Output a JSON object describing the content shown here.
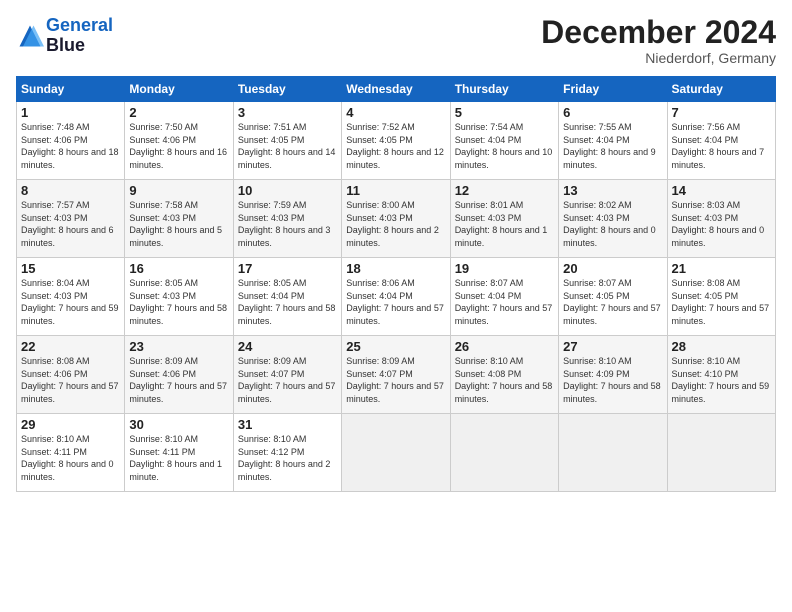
{
  "header": {
    "logo_line1": "General",
    "logo_line2": "Blue",
    "month_title": "December 2024",
    "location": "Niederdorf, Germany"
  },
  "days_of_week": [
    "Sunday",
    "Monday",
    "Tuesday",
    "Wednesday",
    "Thursday",
    "Friday",
    "Saturday"
  ],
  "weeks": [
    [
      {
        "num": "1",
        "sunrise": "7:48 AM",
        "sunset": "4:06 PM",
        "daylight": "8 hours and 18 minutes."
      },
      {
        "num": "2",
        "sunrise": "7:50 AM",
        "sunset": "4:06 PM",
        "daylight": "8 hours and 16 minutes."
      },
      {
        "num": "3",
        "sunrise": "7:51 AM",
        "sunset": "4:05 PM",
        "daylight": "8 hours and 14 minutes."
      },
      {
        "num": "4",
        "sunrise": "7:52 AM",
        "sunset": "4:05 PM",
        "daylight": "8 hours and 12 minutes."
      },
      {
        "num": "5",
        "sunrise": "7:54 AM",
        "sunset": "4:04 PM",
        "daylight": "8 hours and 10 minutes."
      },
      {
        "num": "6",
        "sunrise": "7:55 AM",
        "sunset": "4:04 PM",
        "daylight": "8 hours and 9 minutes."
      },
      {
        "num": "7",
        "sunrise": "7:56 AM",
        "sunset": "4:04 PM",
        "daylight": "8 hours and 7 minutes."
      }
    ],
    [
      {
        "num": "8",
        "sunrise": "7:57 AM",
        "sunset": "4:03 PM",
        "daylight": "8 hours and 6 minutes."
      },
      {
        "num": "9",
        "sunrise": "7:58 AM",
        "sunset": "4:03 PM",
        "daylight": "8 hours and 5 minutes."
      },
      {
        "num": "10",
        "sunrise": "7:59 AM",
        "sunset": "4:03 PM",
        "daylight": "8 hours and 3 minutes."
      },
      {
        "num": "11",
        "sunrise": "8:00 AM",
        "sunset": "4:03 PM",
        "daylight": "8 hours and 2 minutes."
      },
      {
        "num": "12",
        "sunrise": "8:01 AM",
        "sunset": "4:03 PM",
        "daylight": "8 hours and 1 minute."
      },
      {
        "num": "13",
        "sunrise": "8:02 AM",
        "sunset": "4:03 PM",
        "daylight": "8 hours and 0 minutes."
      },
      {
        "num": "14",
        "sunrise": "8:03 AM",
        "sunset": "4:03 PM",
        "daylight": "8 hours and 0 minutes."
      }
    ],
    [
      {
        "num": "15",
        "sunrise": "8:04 AM",
        "sunset": "4:03 PM",
        "daylight": "7 hours and 59 minutes."
      },
      {
        "num": "16",
        "sunrise": "8:05 AM",
        "sunset": "4:03 PM",
        "daylight": "7 hours and 58 minutes."
      },
      {
        "num": "17",
        "sunrise": "8:05 AM",
        "sunset": "4:04 PM",
        "daylight": "7 hours and 58 minutes."
      },
      {
        "num": "18",
        "sunrise": "8:06 AM",
        "sunset": "4:04 PM",
        "daylight": "7 hours and 57 minutes."
      },
      {
        "num": "19",
        "sunrise": "8:07 AM",
        "sunset": "4:04 PM",
        "daylight": "7 hours and 57 minutes."
      },
      {
        "num": "20",
        "sunrise": "8:07 AM",
        "sunset": "4:05 PM",
        "daylight": "7 hours and 57 minutes."
      },
      {
        "num": "21",
        "sunrise": "8:08 AM",
        "sunset": "4:05 PM",
        "daylight": "7 hours and 57 minutes."
      }
    ],
    [
      {
        "num": "22",
        "sunrise": "8:08 AM",
        "sunset": "4:06 PM",
        "daylight": "7 hours and 57 minutes."
      },
      {
        "num": "23",
        "sunrise": "8:09 AM",
        "sunset": "4:06 PM",
        "daylight": "7 hours and 57 minutes."
      },
      {
        "num": "24",
        "sunrise": "8:09 AM",
        "sunset": "4:07 PM",
        "daylight": "7 hours and 57 minutes."
      },
      {
        "num": "25",
        "sunrise": "8:09 AM",
        "sunset": "4:07 PM",
        "daylight": "7 hours and 57 minutes."
      },
      {
        "num": "26",
        "sunrise": "8:10 AM",
        "sunset": "4:08 PM",
        "daylight": "7 hours and 58 minutes."
      },
      {
        "num": "27",
        "sunrise": "8:10 AM",
        "sunset": "4:09 PM",
        "daylight": "7 hours and 58 minutes."
      },
      {
        "num": "28",
        "sunrise": "8:10 AM",
        "sunset": "4:10 PM",
        "daylight": "7 hours and 59 minutes."
      }
    ],
    [
      {
        "num": "29",
        "sunrise": "8:10 AM",
        "sunset": "4:11 PM",
        "daylight": "8 hours and 0 minutes."
      },
      {
        "num": "30",
        "sunrise": "8:10 AM",
        "sunset": "4:11 PM",
        "daylight": "8 hours and 1 minute."
      },
      {
        "num": "31",
        "sunrise": "8:10 AM",
        "sunset": "4:12 PM",
        "daylight": "8 hours and 2 minutes."
      },
      null,
      null,
      null,
      null
    ]
  ]
}
